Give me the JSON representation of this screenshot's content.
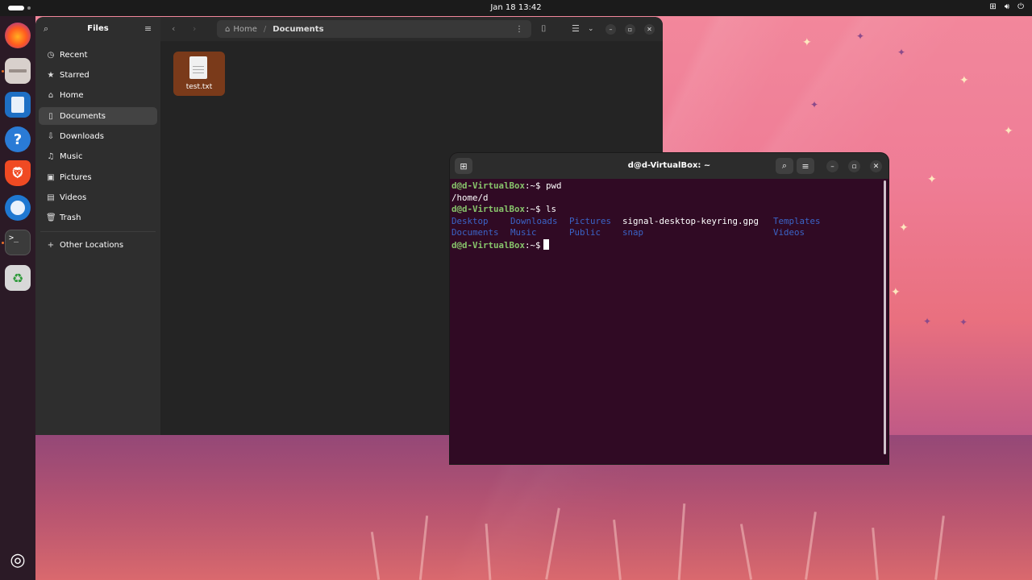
{
  "topbar": {
    "clock": "Jan 18  13:42",
    "icons": [
      "network-icon",
      "volume-icon",
      "power-icon"
    ]
  },
  "dock": {
    "items": [
      "firefox-icon",
      "files-icon",
      "writer-icon",
      "help-icon",
      "brave-icon",
      "thunderbird-icon",
      "terminal-icon",
      "trash-icon"
    ],
    "apps_grid": "ubuntu-logo-icon"
  },
  "files": {
    "sidebar_title": "Files",
    "sidebar_items": [
      {
        "icon": "clock-icon",
        "label": "Recent"
      },
      {
        "icon": "star-icon",
        "label": "Starred"
      },
      {
        "icon": "home-icon",
        "label": "Home"
      },
      {
        "icon": "document-icon",
        "label": "Documents"
      },
      {
        "icon": "download-icon",
        "label": "Downloads"
      },
      {
        "icon": "music-icon",
        "label": "Music"
      },
      {
        "icon": "picture-icon",
        "label": "Pictures"
      },
      {
        "icon": "video-icon",
        "label": "Videos"
      },
      {
        "icon": "trash-icon",
        "label": "Trash"
      }
    ],
    "other_locations": "Other Locations",
    "path": {
      "home": "Home",
      "current": "Documents"
    },
    "files": [
      {
        "name": "test.txt"
      }
    ]
  },
  "terminal": {
    "title": "d@d-VirtualBox: ~",
    "prompt": "d@d-VirtualBox",
    "prompt_suffix": ":~$",
    "cmd1": " pwd",
    "out1": "/home/d",
    "cmd2": " ls",
    "ls_row1": [
      "Desktop",
      "Downloads",
      "Pictures",
      "signal-desktop-keyring.gpg",
      "Templates"
    ],
    "ls_row2": [
      "Documents",
      "Music",
      "Public",
      "snap",
      "Videos"
    ]
  }
}
